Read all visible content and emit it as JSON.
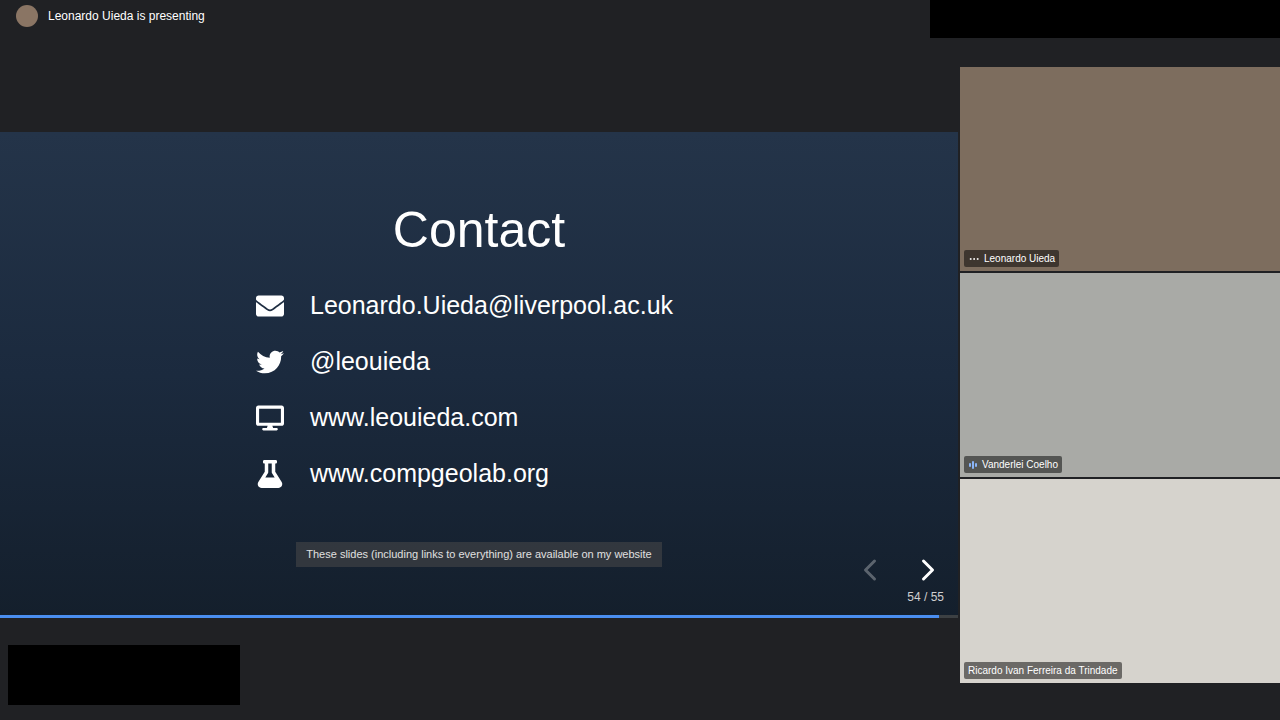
{
  "presenter_bar": {
    "text": "Leonardo Uieda is presenting"
  },
  "slide": {
    "title": "Contact",
    "items": [
      {
        "kind": "email",
        "text": "Leonardo.Uieda@liverpool.ac.uk"
      },
      {
        "kind": "twitter",
        "text": "@leouieda"
      },
      {
        "kind": "website",
        "text": "www.leouieda.com"
      },
      {
        "kind": "lab",
        "text": "www.compgeolab.org"
      }
    ],
    "caption": "These slides (including links to everything) are available on my website",
    "prev": {
      "disabled": true
    },
    "next": {
      "disabled": false
    },
    "page": "54 / 55",
    "progress": 0.98
  },
  "participants": [
    {
      "name": "Leonardo Uieda",
      "kind": "more",
      "color": "#7d6d5e"
    },
    {
      "name": "Vanderlei Coelho",
      "kind": "audio",
      "color": "#a9aaa6"
    },
    {
      "name": "Ricardo Ivan Ferreira da Trindade",
      "kind": "none",
      "color": "#d6d3cd"
    }
  ]
}
